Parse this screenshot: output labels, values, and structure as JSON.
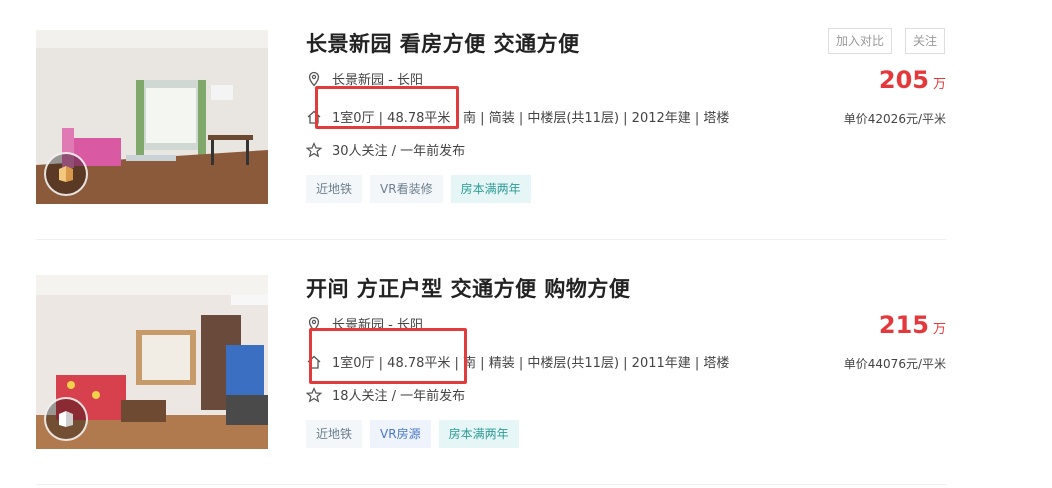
{
  "listings": [
    {
      "title": "长景新园 看房方便 交通方便",
      "location": "长景新园 - 长阳",
      "details": "1室0厅 | 48.78平米 | 南 | 简装 | 中楼层(共11层) | 2012年建 | 塔楼",
      "followers": "30人关注 / 一年前发布",
      "tags": [
        "近地铁",
        "VR看装修",
        "房本满两年"
      ],
      "tag_styles": [
        "gray",
        "gray",
        "teal"
      ],
      "compare_label": "加入对比",
      "follow_label": "关注",
      "price": "205",
      "price_unit": "万",
      "unit_price": "单价42026元/平米"
    },
    {
      "title": "开间 方正户型 交通方便 购物方便",
      "location": "长景新园 - 长阳",
      "details": "1室0厅 | 48.78平米 | 南 | 精装 | 中楼层(共11层) | 2011年建 | 塔楼",
      "followers": "18人关注 / 一年前发布",
      "tags": [
        "近地铁",
        "VR房源",
        "房本满两年"
      ],
      "tag_styles": [
        "gray",
        "blue",
        "teal"
      ],
      "price": "215",
      "price_unit": "万",
      "unit_price": "单价44076元/平米"
    }
  ],
  "colors": {
    "price": "#e4393c",
    "highlight_box": "#e23b3b"
  }
}
